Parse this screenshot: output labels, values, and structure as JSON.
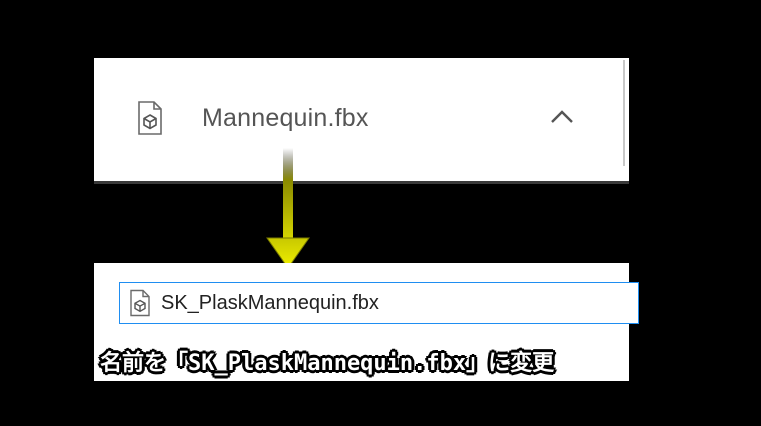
{
  "download_bar": {
    "filename": "Mannequin.fbx",
    "file_icon": "3d-object-file-icon",
    "expand_icon": "chevron-up-icon"
  },
  "rename": {
    "file_icon": "3d-object-file-icon",
    "value": "SK_PlaskMannequin.fbx",
    "field_border_color": "#1f8ef1"
  },
  "arrow": {
    "direction": "down",
    "color": "#d8d800"
  },
  "caption": {
    "text": "名前を「SK_PlaskMannequin.fbx」に変更"
  }
}
